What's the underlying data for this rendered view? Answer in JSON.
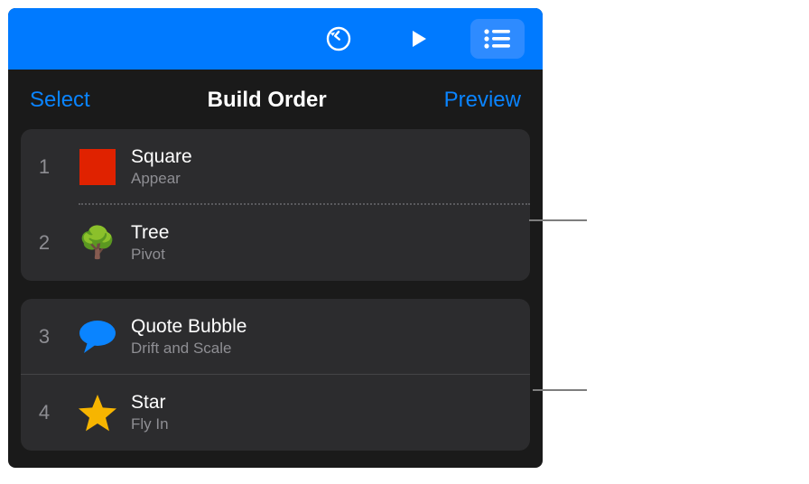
{
  "toolbar": {
    "undo_icon": "undo",
    "play_icon": "play",
    "list_icon": "list"
  },
  "subbar": {
    "select_label": "Select",
    "title": "Build Order",
    "preview_label": "Preview"
  },
  "groups": [
    {
      "items": [
        {
          "num": "1",
          "name": "Square",
          "effect": "Appear",
          "icon": "square"
        },
        {
          "num": "2",
          "name": "Tree",
          "effect": "Pivot",
          "icon": "tree"
        }
      ]
    },
    {
      "items": [
        {
          "num": "3",
          "name": "Quote Bubble",
          "effect": "Drift and Scale",
          "icon": "bubble"
        },
        {
          "num": "4",
          "name": "Star",
          "effect": "Fly In",
          "icon": "star"
        }
      ]
    }
  ],
  "colors": {
    "accent": "#007aff",
    "square": "#e02200",
    "bubble": "#0a84ff",
    "star": "#f7b500",
    "tree": "#2fa82f"
  }
}
